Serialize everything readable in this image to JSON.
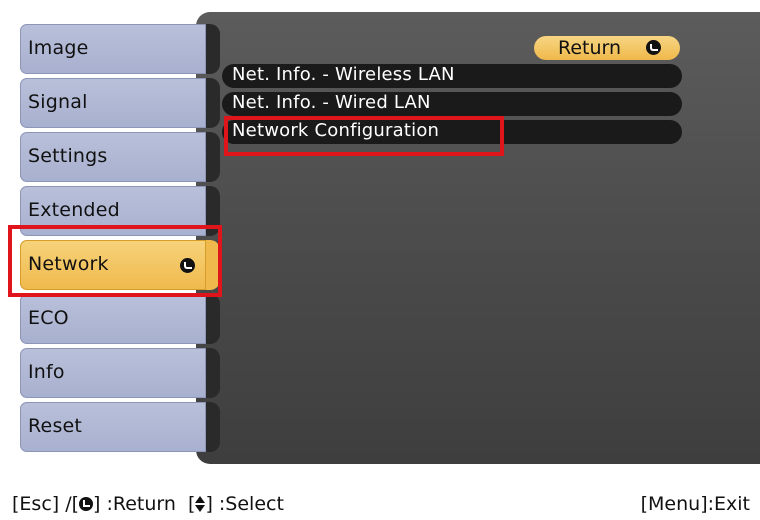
{
  "sidebar": {
    "items": [
      {
        "label": "Image"
      },
      {
        "label": "Signal"
      },
      {
        "label": "Settings"
      },
      {
        "label": "Extended"
      },
      {
        "label": "Network",
        "selected": true
      },
      {
        "label": "ECO"
      },
      {
        "label": "Info"
      },
      {
        "label": "Reset"
      }
    ]
  },
  "content": {
    "return_label": "Return",
    "options": [
      {
        "label": "Net. Info. - Wireless LAN"
      },
      {
        "label": "Net. Info. - Wired LAN"
      },
      {
        "label": "Network Configuration",
        "highlighted": true
      }
    ]
  },
  "help": {
    "esc_prefix": "[Esc] /[",
    "esc_suffix": "] :Return",
    "select_prefix": "[",
    "select_suffix": "] :Select",
    "exit": "[Menu]:Exit"
  },
  "colors": {
    "accent": "#f0b94c",
    "sidebar": "#b0b8d4",
    "panel": "#4a4a4a",
    "highlight": "#e0141b"
  },
  "icons": {
    "enter": "enter-icon",
    "updown": "up-down-arrow-icon"
  }
}
